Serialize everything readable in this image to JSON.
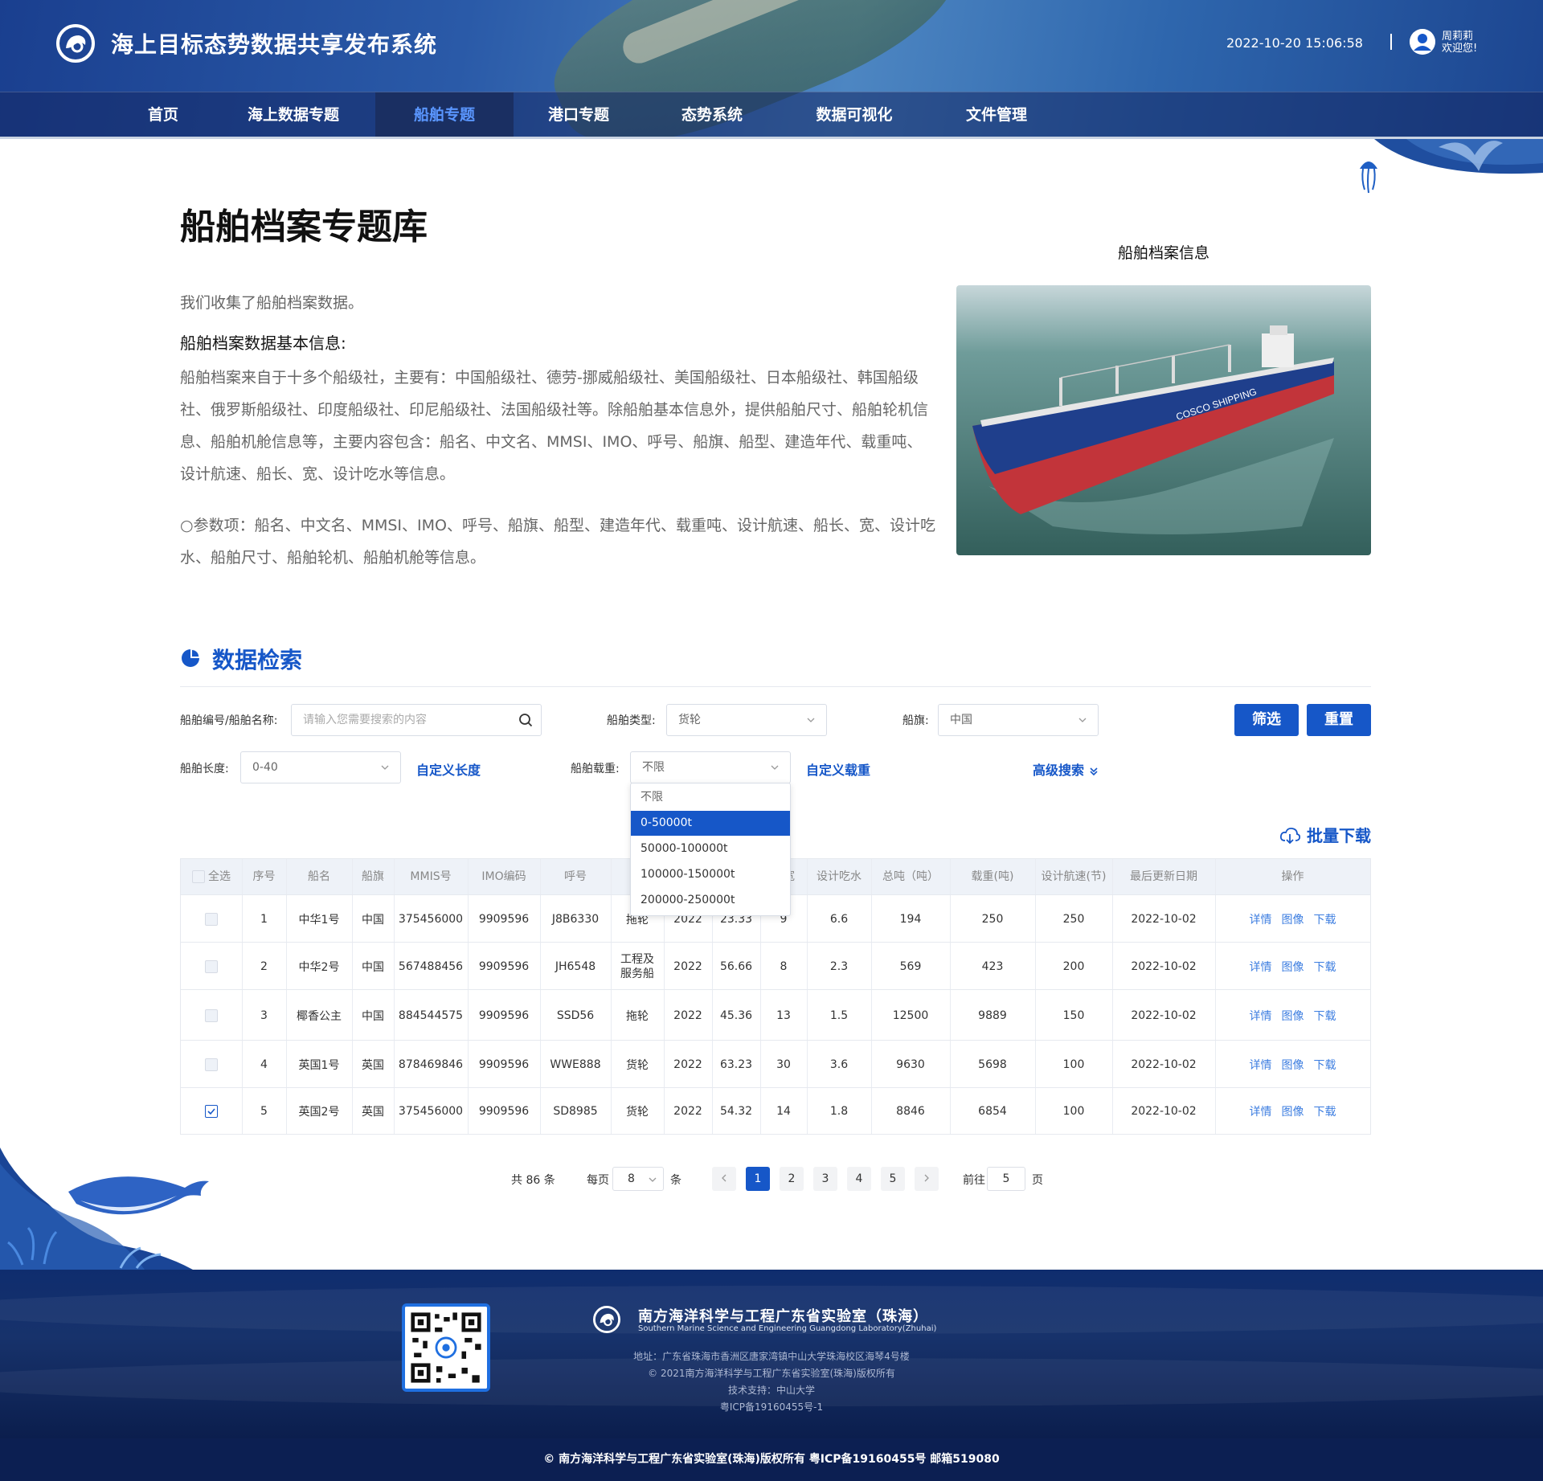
{
  "header": {
    "title": "海上目标态势数据共享发布系统",
    "datetime": "2022-10-20 15:06:58",
    "user_name": "周莉莉",
    "user_greeting": "欢迎您!"
  },
  "nav": {
    "items": [
      "首页",
      "海上数据专题",
      "船舶专题",
      "港口专题",
      "态势系统",
      "数据可视化",
      "文件管理"
    ],
    "active": "船舶专题"
  },
  "intro": {
    "title": "船舶档案专题库",
    "p1": "我们收集了船舶档案数据。",
    "subheading": "船舶档案数据基本信息:",
    "p2": "船舶档案来自于十多个船级社，主要有：中国船级社、德劳-挪威船级社、美国船级社、日本船级社、韩国船级社、俄罗斯船级社、印度船级社、印尼船级社、法国船级社等。除船舶基本信息外，提供船舶尺寸、船舶轮机信息、船舶机舱信息等，主要内容包含：船名、中文名、MMSI、IMO、呼号、船旗、船型、建造年代、载重吨、设计航速、船长、宽、设计吃水等信息。",
    "p3": "○参数项：船名、中文名、MMSI、IMO、呼号、船旗、船型、建造年代、载重吨、设计航速、船长、宽、设计吃水、船舶尺寸、船舶轮机、船舶机舱等信息。",
    "image_caption": "船舶档案信息"
  },
  "search": {
    "section_title": "数据检索",
    "name_label": "船舶编号/船舶名称:",
    "name_placeholder": "请输入您需要搜索的内容",
    "type_label": "船舶类型:",
    "type_value": "货轮",
    "flag_label": "船旗:",
    "flag_value": "中国",
    "filter_button": "筛选",
    "reset_button": "重置",
    "length_label": "船舶长度:",
    "length_value": "0-40",
    "custom_length": "自定义长度",
    "weight_label": "船舶载重:",
    "weight_value": "不限",
    "custom_weight": "自定义载重",
    "advanced_search": "高级搜索",
    "weight_options": [
      "不限",
      "0-50000t",
      "50000-100000t",
      "100000-150000t",
      "200000-250000t"
    ],
    "weight_selected": "0-50000t",
    "batch_download": "批量下载"
  },
  "table": {
    "select_all": "全选",
    "headers": [
      "序号",
      "船名",
      "船旗",
      "MMIS号",
      "IMO编码",
      "呼号",
      "",
      "",
      "",
      "船宽",
      "设计吃水",
      "总吨（吨）",
      "载重(吨)",
      "设计航速(节)",
      "最后更新日期",
      "操作"
    ],
    "rows": [
      {
        "no": "1",
        "name": "中华1号",
        "flag": "中国",
        "mmsi": "375456000",
        "imo": "9909596",
        "callsign": "J8B6330",
        "type": "拖轮",
        "year": "2022",
        "length": "23.33",
        "width": "9",
        "draft": "6.6",
        "gross": "194",
        "dwt": "250",
        "speed": "250",
        "date": "2022-10-02",
        "checked": false
      },
      {
        "no": "2",
        "name": "中华2号",
        "flag": "中国",
        "mmsi": "567488456",
        "imo": "9909596",
        "callsign": "JH6548",
        "type": "工程及服务船",
        "year": "2022",
        "length": "56.66",
        "width": "8",
        "draft": "2.3",
        "gross": "569",
        "dwt": "423",
        "speed": "200",
        "date": "2022-10-02",
        "checked": false
      },
      {
        "no": "3",
        "name": "椰香公主",
        "flag": "中国",
        "mmsi": "884544575",
        "imo": "9909596",
        "callsign": "SSD56",
        "type": "拖轮",
        "year": "2022",
        "length": "45.36",
        "width": "13",
        "draft": "1.5",
        "gross": "12500",
        "dwt": "9889",
        "speed": "150",
        "date": "2022-10-02",
        "checked": false
      },
      {
        "no": "4",
        "name": "英国1号",
        "flag": "英国",
        "mmsi": "878469846",
        "imo": "9909596",
        "callsign": "WWE888",
        "type": "货轮",
        "year": "2022",
        "length": "63.23",
        "width": "30",
        "draft": "3.6",
        "gross": "9630",
        "dwt": "5698",
        "speed": "100",
        "date": "2022-10-02",
        "checked": false
      },
      {
        "no": "5",
        "name": "英国2号",
        "flag": "英国",
        "mmsi": "375456000",
        "imo": "9909596",
        "callsign": "SD8985",
        "type": "货轮",
        "year": "2022",
        "length": "54.32",
        "width": "14",
        "draft": "1.8",
        "gross": "8846",
        "dwt": "6854",
        "speed": "100",
        "date": "2022-10-02",
        "checked": true
      }
    ],
    "actions": [
      "详情",
      "图像",
      "下载"
    ]
  },
  "pagination": {
    "total": "共 86 条",
    "per_page_label": "每页",
    "per_page_value": "8",
    "per_page_unit": "条",
    "pages": [
      "1",
      "2",
      "3",
      "4",
      "5"
    ],
    "current": "1",
    "goto_label": "前往",
    "goto_value": "5",
    "goto_unit": "页"
  },
  "footer": {
    "org_name": "南方海洋科学与工程广东省实验室（珠海）",
    "org_name_en": "Southern Marine Science and Engineering Guangdong Laboratory(Zhuhai)",
    "address": "地址：广东省珠海市香洲区唐家湾镇中山大学珠海校区海琴4号楼",
    "copyright": "© 2021南方海洋科学与工程广东省实验室(珠海)版权所有",
    "support": "技术支持：中山大学",
    "icp": "粤ICP备19160455号-1",
    "bottom_bar": "© 南方海洋科学与工程广东省实验室(珠海)版权所有    粤ICP备19160455号    邮箱519080"
  },
  "colors": {
    "accent": "#1657c8",
    "header_dark": "#1a2f62",
    "footer": "#0c1f52"
  },
  "icons": [
    "logo-icon",
    "user-avatar-icon",
    "search-icon",
    "chevron-down-icon",
    "pie-chart-icon",
    "download-icon",
    "qr-code-icon",
    "whale-icon",
    "jellyfish-icon"
  ]
}
